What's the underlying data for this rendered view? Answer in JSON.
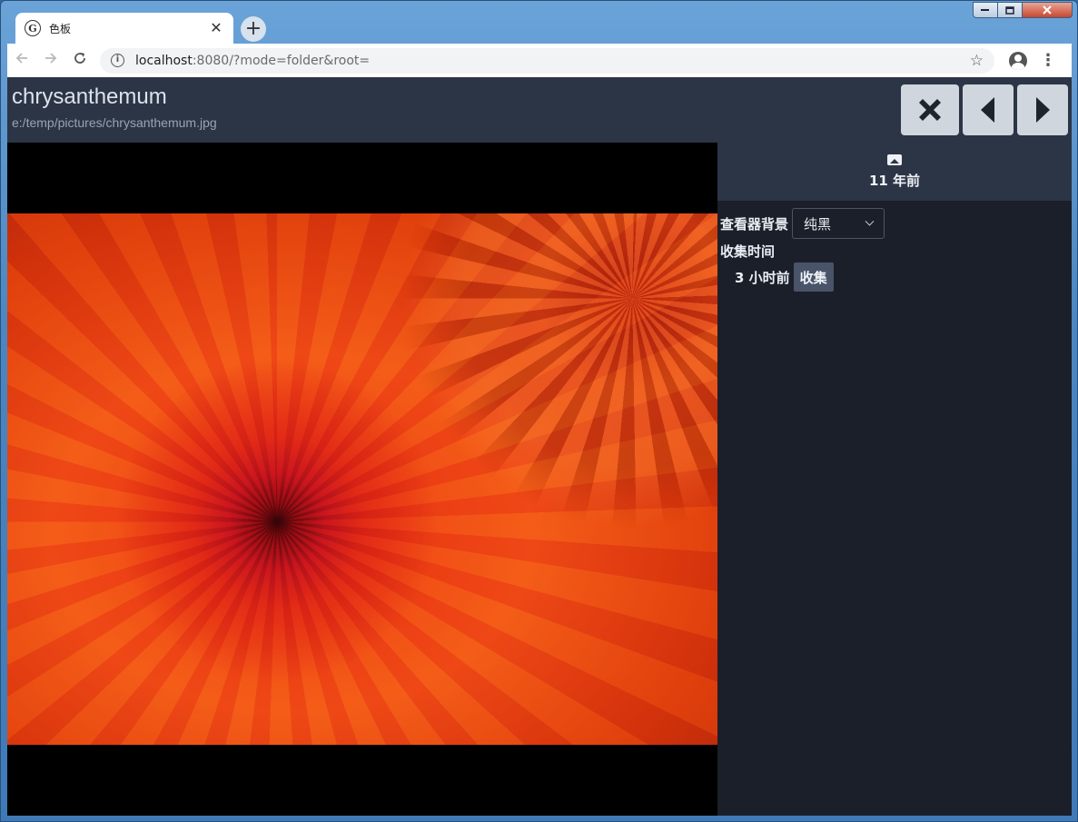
{
  "browser": {
    "tab_title": "色板",
    "favicon_glyph": "G",
    "tab_close": "✕",
    "new_tab": "+",
    "url_host": "localhost",
    "url_rest": ":8080/?mode=folder&root="
  },
  "header": {
    "title": "chrysanthemum",
    "path": "e:/temp/pictures/chrysanthemum.jpg"
  },
  "sidebar": {
    "age": "11 年前",
    "background_label": "查看器背景",
    "background_value": "纯黑",
    "collect_time_label": "收集时间",
    "collect_time_value": "3 小时前",
    "collect_button": "收集"
  },
  "colors": {
    "header_bg": "#2c3546",
    "page_bg": "#1b1f2a",
    "button_bg": "#cfd6de",
    "collect_button_bg": "#4a5468"
  }
}
